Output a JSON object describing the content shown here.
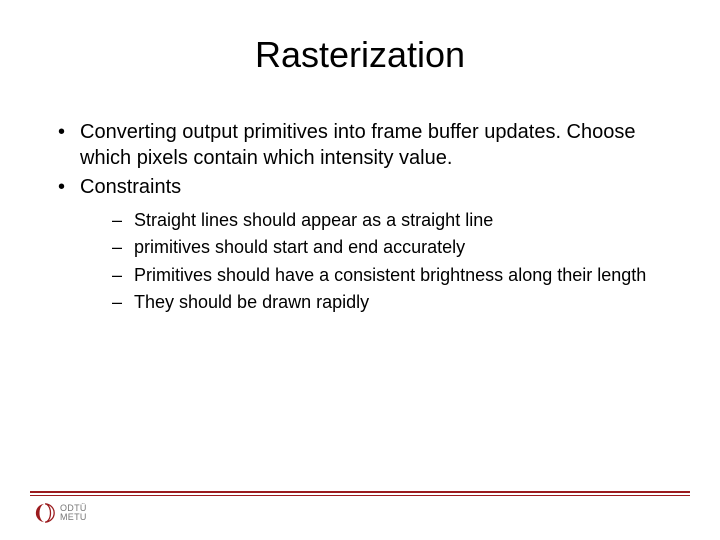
{
  "title": "Rasterization",
  "bullets": [
    {
      "text": "Converting output primitives into frame buffer updates. Choose which pixels contain which intensity value."
    },
    {
      "text": "Constraints",
      "sub": [
        "Straight lines should appear as a straight line",
        "primitives should start and end accurately",
        "Primitives should have a consistent brightness along their length",
        "They should be drawn rapidly"
      ]
    }
  ],
  "logo": {
    "line1": "ODTÜ",
    "line2": "METU"
  }
}
